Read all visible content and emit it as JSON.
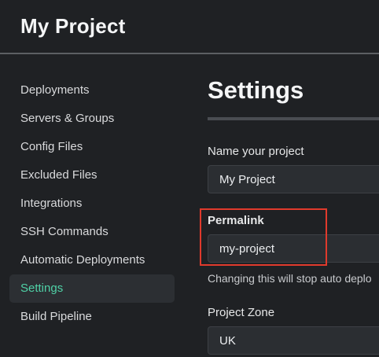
{
  "header": {
    "project_title": "My Project"
  },
  "sidebar": {
    "items": [
      {
        "label": "Deployments"
      },
      {
        "label": "Servers & Groups"
      },
      {
        "label": "Config Files"
      },
      {
        "label": "Excluded Files"
      },
      {
        "label": "Integrations"
      },
      {
        "label": "SSH Commands"
      },
      {
        "label": "Automatic Deployments"
      },
      {
        "label": "Settings",
        "active": true
      },
      {
        "label": "Build Pipeline"
      }
    ]
  },
  "main": {
    "title": "Settings",
    "project_name": {
      "label": "Name your project",
      "value": "My Project"
    },
    "permalink": {
      "label": "Permalink",
      "value": "my-project",
      "hint": "Changing this will stop auto deplo"
    },
    "project_zone": {
      "label": "Project Zone",
      "value": "UK"
    }
  },
  "colors": {
    "background": "#1f2124",
    "active_accent": "#4fd1a6",
    "highlight_border": "#e03a2c",
    "input_bg": "#2b2e32"
  }
}
